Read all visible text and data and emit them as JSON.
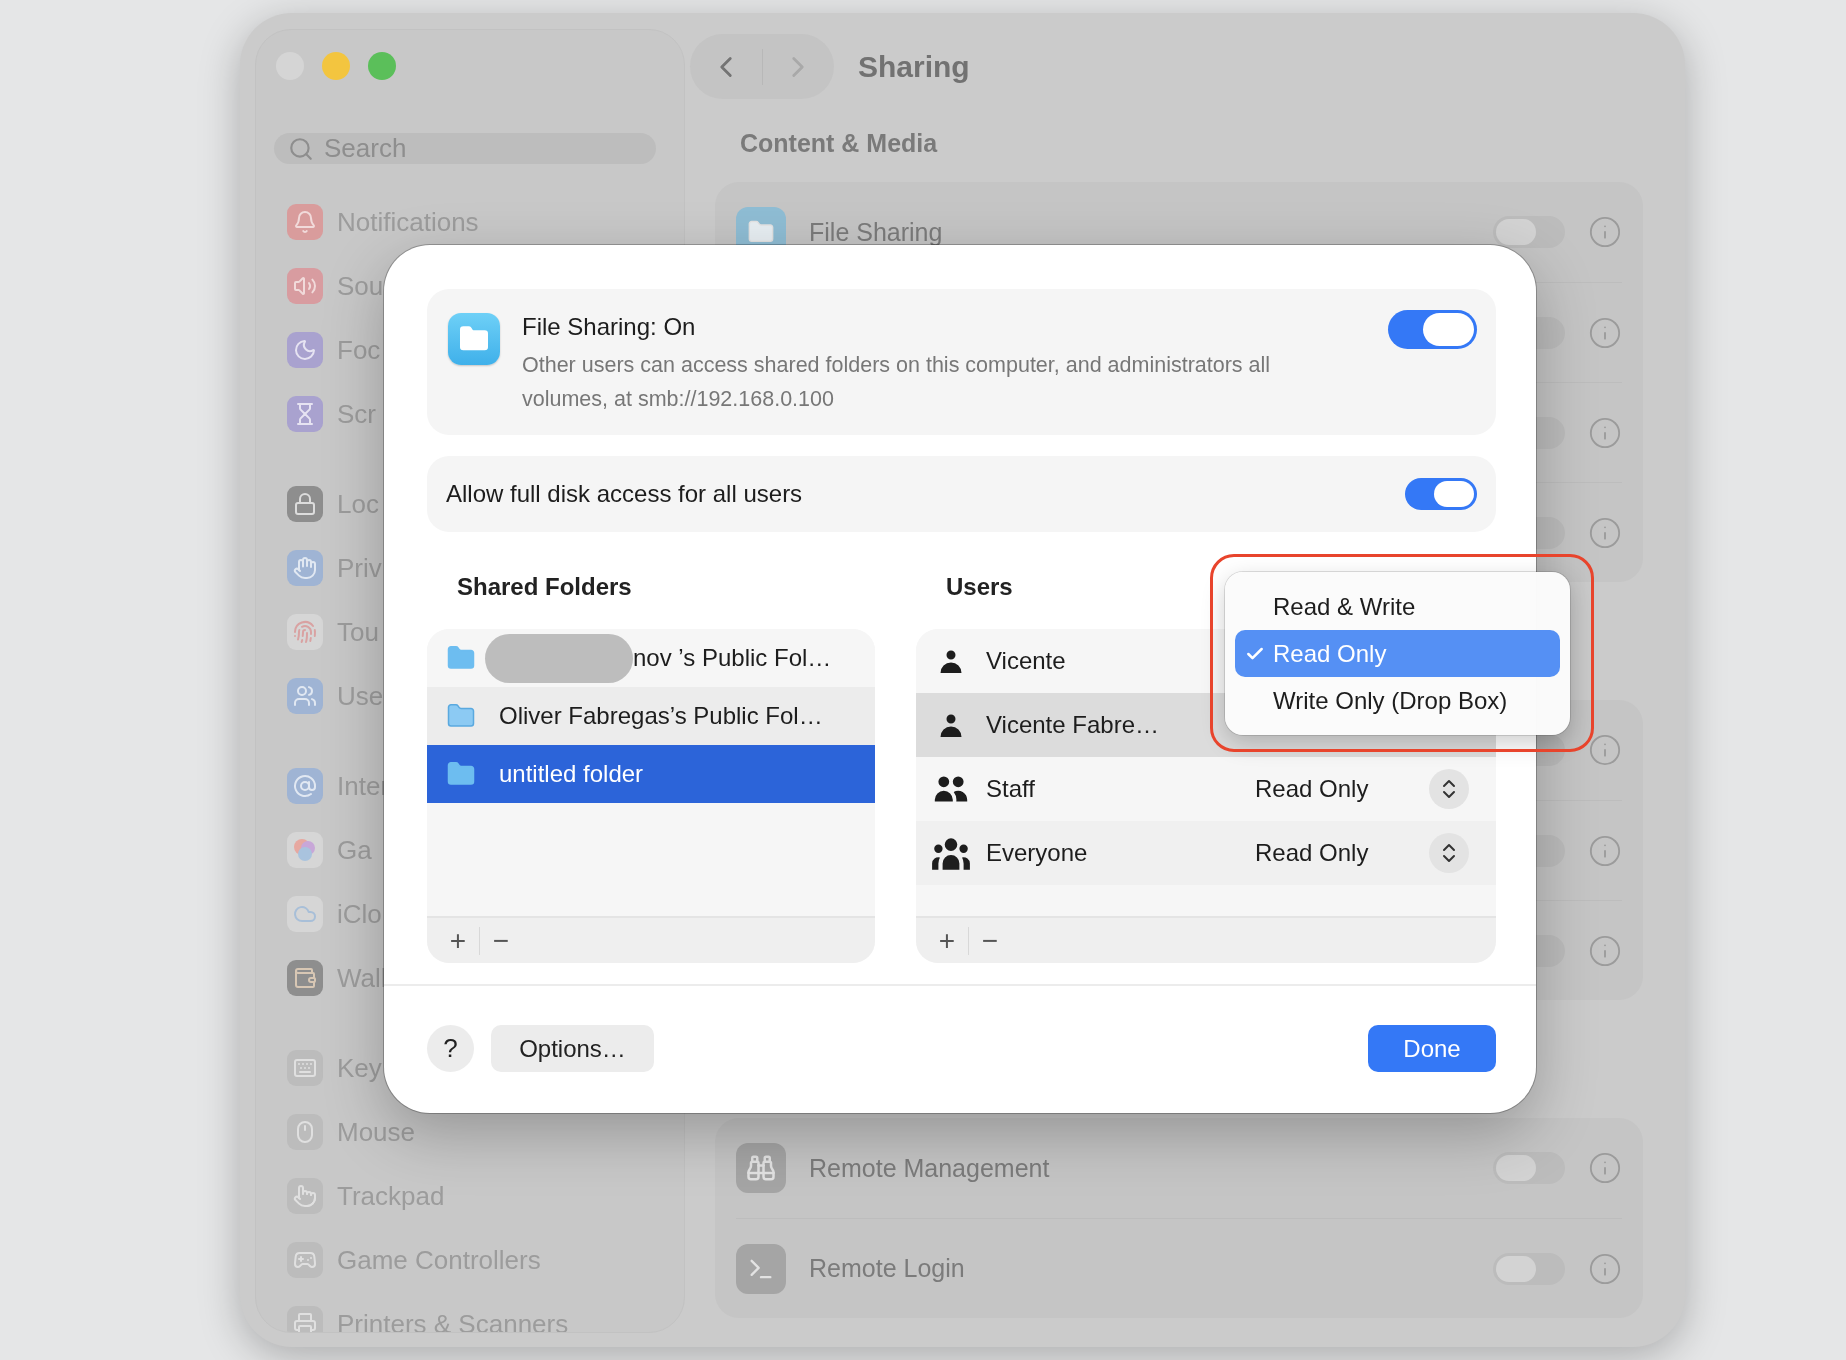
{
  "window": {
    "title": "Sharing",
    "section_title": "Content & Media",
    "nav": {
      "back": {
        "disabled": false
      },
      "forward": {
        "disabled": true
      }
    }
  },
  "sidebar": {
    "search": {
      "placeholder": "Search"
    },
    "groups": [
      {
        "items": [
          {
            "label": "Notifications"
          },
          {
            "label": "Sou"
          },
          {
            "label": "Foc"
          },
          {
            "label": "Scr"
          }
        ]
      },
      {
        "items": [
          {
            "label": "Loc"
          },
          {
            "label": "Priv"
          },
          {
            "label": "Tou"
          },
          {
            "label": "Use"
          }
        ]
      },
      {
        "items": [
          {
            "label": "Inter"
          },
          {
            "label": "Ga"
          },
          {
            "label": "iClo"
          },
          {
            "label": "Wall"
          }
        ]
      },
      {
        "items": [
          {
            "label": "Key"
          },
          {
            "label": "Mouse"
          },
          {
            "label": "Trackpad"
          },
          {
            "label": "Game Controllers"
          },
          {
            "label": "Printers & Scanners"
          }
        ]
      }
    ]
  },
  "content": {
    "groups": [
      {
        "rows": [
          {
            "label": "File Sharing",
            "on": false
          },
          {
            "on": false
          },
          {
            "on": false
          },
          {
            "on": false
          }
        ]
      },
      {
        "rows": [
          {
            "on": false
          },
          {
            "on": false
          },
          {
            "on": false
          }
        ]
      },
      {
        "rows": [
          {
            "label": "Remote Management",
            "on": false
          },
          {
            "label": "Remote Login",
            "on": false
          }
        ]
      }
    ]
  },
  "dialog": {
    "status": {
      "title": "File Sharing: On",
      "description": "Other users can access shared folders on this computer, and administrators all volumes, at smb://192.168.0.100",
      "on": true
    },
    "full_disk": {
      "label": "Allow full disk access for all users",
      "on": true
    },
    "shared_folders": {
      "heading": "Shared Folders",
      "items": [
        {
          "name": "nov ’s Public Fol…",
          "kind": "folder",
          "redacted": true,
          "selected": false
        },
        {
          "name": "Oliver Fabregas’s Public Fol…",
          "kind": "public",
          "redacted": false,
          "selected": false
        },
        {
          "name": "untitled folder",
          "kind": "folder",
          "redacted": false,
          "selected": true
        }
      ],
      "buttons": [
        "+",
        "−"
      ]
    },
    "users": {
      "heading": "Users",
      "items": [
        {
          "name": "Vicente",
          "kind": "user",
          "selected": false
        },
        {
          "name": "Vicente Fabre…",
          "kind": "user",
          "selected": true
        },
        {
          "name": "Staff",
          "kind": "group",
          "permission": "Read Only",
          "selected": false
        },
        {
          "name": "Everyone",
          "kind": "everyone",
          "permission": "Read Only",
          "selected": false
        }
      ],
      "buttons": [
        "+",
        "−"
      ]
    },
    "help": "?",
    "options": "Options…",
    "done": "Done"
  },
  "popup_menu": {
    "items": [
      {
        "label": "Read & Write",
        "selected": false
      },
      {
        "label": "Read Only",
        "selected": true
      },
      {
        "label": "Write Only (Drop Box)",
        "selected": false
      }
    ]
  }
}
